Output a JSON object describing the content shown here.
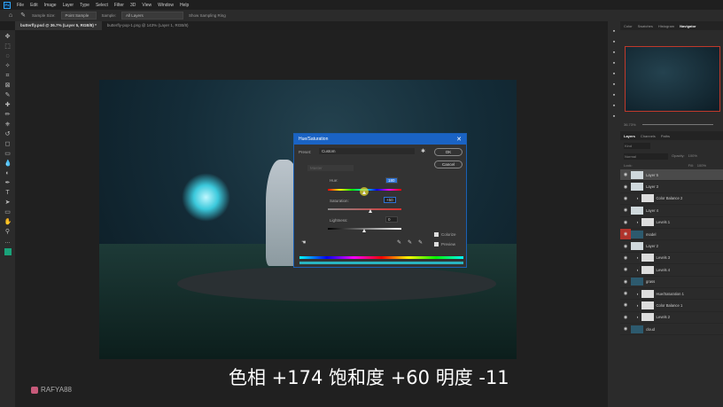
{
  "app_icon": "Ps",
  "menu": [
    "File",
    "Edit",
    "Image",
    "Layer",
    "Type",
    "Select",
    "Filter",
    "3D",
    "View",
    "Window",
    "Help"
  ],
  "options": {
    "sample_size_label": "Sample Size:",
    "sample_size_value": "Point Sample",
    "sample_label": "Sample:",
    "sample_value": "All Layers",
    "show_ring": "Show Sampling Ring"
  },
  "tabs": [
    "butterfly.psd @ 36.7% (Layer 5, RGB/8) *",
    "butterfly-pop-1.png @ 143% (Layer 1, RGB/8)"
  ],
  "dialog": {
    "title": "Hue/Saturation",
    "preset_label": "Preset:",
    "preset_value": "Custom",
    "ok": "OK",
    "cancel": "Cancel",
    "channel": "Master",
    "hue_label": "Hue:",
    "hue_value": "180",
    "sat_label": "Saturation:",
    "sat_value": "+50",
    "light_label": "Lightness:",
    "light_value": "0",
    "colorize": "Colorize",
    "preview": "Preview",
    "colorize_checked": true,
    "preview_checked": true
  },
  "panels": {
    "top_tabs": [
      "Color",
      "Swatches",
      "Histogram",
      "Navigator"
    ],
    "zoom": "36.73%",
    "layer_tabs": [
      "Layers",
      "Channels",
      "Paths"
    ],
    "kind": "Kind",
    "blend": "Normal",
    "opacity_label": "Opacity:",
    "opacity": "100%",
    "lock_label": "Lock:",
    "fill_label": "Fill:",
    "fill": "100%"
  },
  "layers": [
    {
      "name": "Layer 5",
      "selected": true
    },
    {
      "name": "Layer 3"
    },
    {
      "name": "Color Balance 2",
      "adj": true
    },
    {
      "name": "Layer 4"
    },
    {
      "name": "Levels 1",
      "adj": true
    },
    {
      "name": "model",
      "red": true
    },
    {
      "name": "Layer 2"
    },
    {
      "name": "Levels 3",
      "adj": true
    },
    {
      "name": "Levels 4",
      "adj": true
    },
    {
      "name": "grass"
    },
    {
      "name": "Hue/Saturation 1",
      "adj": true
    },
    {
      "name": "Color Balance 1",
      "adj": true
    },
    {
      "name": "Levels 2",
      "adj": true
    },
    {
      "name": "cloud"
    }
  ],
  "subtitle": "色相 +174 饱和度 +60 明度 -11",
  "watermark": "RAFYA88"
}
